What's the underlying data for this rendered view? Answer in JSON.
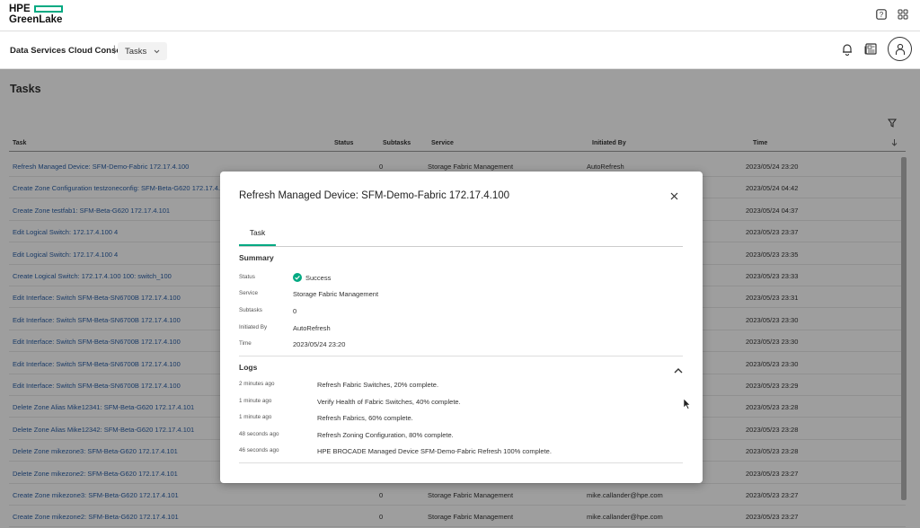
{
  "header": {
    "logo_line1": "HPE",
    "logo_line2": "GreenLake",
    "colors": {
      "brand_green": "#01a982"
    },
    "icons": [
      "help-icon",
      "app-grid-icon"
    ]
  },
  "subheader": {
    "console_title": "Data Services Cloud Console",
    "separator": "|",
    "dropdown_label": "Tasks",
    "icons": [
      "bell-icon",
      "feed-icon",
      "user-avatar-icon"
    ]
  },
  "page": {
    "title": "Tasks",
    "table": {
      "columns": [
        "Task",
        "Status",
        "Subtasks",
        "Service",
        "Initiated By",
        "Time"
      ],
      "rows": [
        {
          "task": "Refresh Managed Device: SFM-Demo-Fabric 172.17.4.100",
          "subtasks": "0",
          "service": "Storage Fabric Management",
          "by": "AutoRefresh",
          "time": "2023/05/24 23:20"
        },
        {
          "task": "Create Zone Configuration testzoneconfig: SFM-Beta-G620 172.17.4.101",
          "subtasks": "",
          "service": "",
          "by": "",
          "time": "2023/05/24 04:42"
        },
        {
          "task": "Create Zone testfab1: SFM-Beta-G620 172.17.4.101",
          "subtasks": "",
          "service": "",
          "by": "",
          "time": "2023/05/24 04:37"
        },
        {
          "task": "Edit Logical Switch: 172.17.4.100 4",
          "subtasks": "",
          "service": "",
          "by": "",
          "time": "2023/05/23 23:37"
        },
        {
          "task": "Edit Logical Switch: 172.17.4.100 4",
          "subtasks": "",
          "service": "",
          "by": "",
          "time": "2023/05/23 23:35"
        },
        {
          "task": "Create Logical Switch: 172.17.4.100 100: switch_100",
          "subtasks": "",
          "service": "",
          "by": "",
          "time": "2023/05/23 23:33"
        },
        {
          "task": "Edit Interface: Switch SFM-Beta-SN6700B 172.17.4.100",
          "subtasks": "",
          "service": "",
          "by": "",
          "time": "2023/05/23 23:31"
        },
        {
          "task": "Edit Interface: Switch SFM-Beta-SN6700B 172.17.4.100",
          "subtasks": "",
          "service": "",
          "by": "",
          "time": "2023/05/23 23:30"
        },
        {
          "task": "Edit Interface: Switch SFM-Beta-SN6700B 172.17.4.100",
          "subtasks": "",
          "service": "",
          "by": "",
          "time": "2023/05/23 23:30"
        },
        {
          "task": "Edit Interface: Switch SFM-Beta-SN6700B 172.17.4.100",
          "subtasks": "",
          "service": "",
          "by": "",
          "time": "2023/05/23 23:30"
        },
        {
          "task": "Edit Interface: Switch SFM-Beta-SN6700B 172.17.4.100",
          "subtasks": "",
          "service": "",
          "by": "",
          "time": "2023/05/23 23:29"
        },
        {
          "task": "Delete Zone Alias Mike12341: SFM-Beta-G620 172.17.4.101",
          "subtasks": "",
          "service": "",
          "by": "",
          "time": "2023/05/23 23:28"
        },
        {
          "task": "Delete Zone Alias Mike12342: SFM-Beta-G620 172.17.4.101",
          "subtasks": "",
          "service": "",
          "by": "",
          "time": "2023/05/23 23:28"
        },
        {
          "task": "Delete Zone mikezone3: SFM-Beta-G620 172.17.4.101",
          "subtasks": "",
          "service": "",
          "by": "",
          "time": "2023/05/23 23:28"
        },
        {
          "task": "Delete Zone mikezone2: SFM-Beta-G620 172.17.4.101",
          "subtasks": "",
          "service": "",
          "by": "",
          "time": "2023/05/23 23:27"
        },
        {
          "task": "Create Zone mikezone3: SFM-Beta-G620 172.17.4.101",
          "subtasks": "0",
          "service": "Storage Fabric Management",
          "by": "mike.callander@hpe.com",
          "time": "2023/05/23 23:27"
        },
        {
          "task": "Create Zone mikezone2: SFM-Beta-G620 172.17.4.101",
          "subtasks": "0",
          "service": "Storage Fabric Management",
          "by": "mike.callander@hpe.com",
          "time": "2023/05/23 23:27"
        }
      ]
    }
  },
  "modal": {
    "title": "Refresh Managed Device: SFM-Demo-Fabric 172.17.4.100",
    "tab": "Task",
    "summary_title": "Summary",
    "summary": {
      "status_label": "Status",
      "status_value": "Success",
      "service_label": "Service",
      "service_value": "Storage Fabric Management",
      "subtasks_label": "Subtasks",
      "subtasks_value": "0",
      "initiated_label": "Initiated By",
      "initiated_value": "AutoRefresh",
      "time_label": "Time",
      "time_value": "2023/05/24 23:20"
    },
    "logs_title": "Logs",
    "logs": [
      {
        "time": "2 minutes ago",
        "message": "Refresh Fabric Switches, 20% complete."
      },
      {
        "time": "1 minute ago",
        "message": "Verify Health of Fabric Switches, 40% complete."
      },
      {
        "time": "1 minute ago",
        "message": "Refresh Fabrics, 60% complete."
      },
      {
        "time": "48 seconds ago",
        "message": "Refresh Zoning Configuration, 80% complete."
      },
      {
        "time": "46 seconds ago",
        "message": "HPE BROCADE Managed Device SFM-Demo-Fabric Refresh 100% complete."
      }
    ],
    "colors": {
      "success": "#01a982"
    }
  }
}
